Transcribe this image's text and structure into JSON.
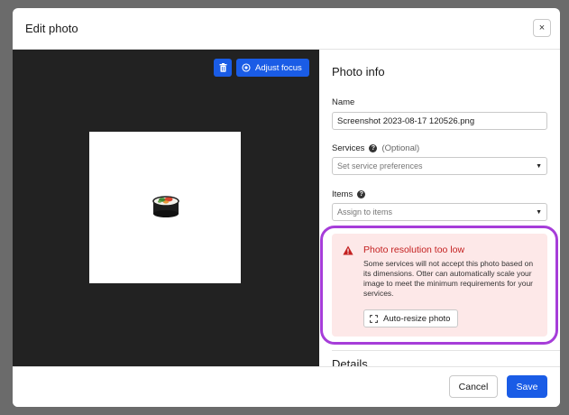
{
  "modal": {
    "title": "Edit photo",
    "close_label": "×"
  },
  "preview": {
    "adjust_focus_label": "Adjust focus",
    "background_color": "#222222",
    "icons": {
      "trash": "trash-icon",
      "focus": "target-icon"
    }
  },
  "photo_info": {
    "title": "Photo info",
    "name_label": "Name",
    "name_value": "Screenshot 2023-08-17 120526.png",
    "services_label": "Services",
    "services_optional": "(Optional)",
    "services_placeholder": "Set service preferences",
    "items_label": "Items",
    "items_placeholder": "Assign to items",
    "help_glyph": "?"
  },
  "warning": {
    "title": "Photo resolution too low",
    "body": "Some services will not accept this photo based on its dimensions. Otter can automatically scale your image to meet the minimum requirements for your services.",
    "button_label": "Auto-resize photo",
    "highlight_color": "#a63dd9",
    "title_color": "#c42020",
    "background_color": "#fde8e8"
  },
  "details": {
    "heading": "Details"
  },
  "footer": {
    "cancel_label": "Cancel",
    "save_label": "Save",
    "accent_color": "#1a5ce6"
  }
}
